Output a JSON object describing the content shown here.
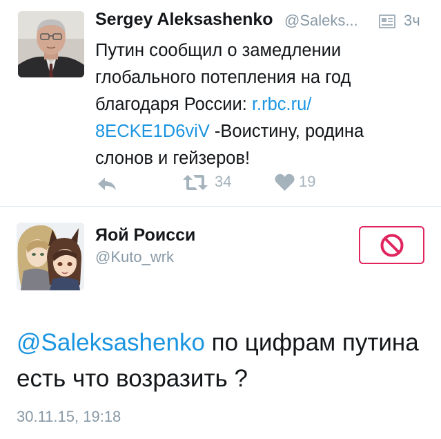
{
  "tweet1": {
    "author_name": "Sergey Aleksashenko",
    "author_handle": "@Saleks...",
    "time": "3ч",
    "text_before_link": "Путин сообщил о замедлении глобального потепления на год благодаря России: ",
    "link_text": "r.rbc.ru/ 8ECKE1D6viV",
    "text_after_link": " -Воистину, родина слонов и гейзеров!",
    "retweet_count": "34",
    "like_count": "19",
    "icons": {
      "reply": "reply-icon",
      "retweet": "retweet-icon",
      "like": "heart-icon",
      "card": "summary-card-icon"
    }
  },
  "tweet2": {
    "author_name": "Яой Роисси",
    "author_handle": "@Kuto_wrk",
    "mention": "@Saleksashenko",
    "text": " по цифрам путина есть что возразить ?",
    "timestamp": "30.11.15, 19:18",
    "block_button_icon": "block-icon"
  },
  "colors": {
    "link": "#1b95e0",
    "secondary_text": "#8899a6",
    "action_icons": "#a5b3bd",
    "block_red": "#e0245e",
    "divider": "#e1e8ed"
  }
}
